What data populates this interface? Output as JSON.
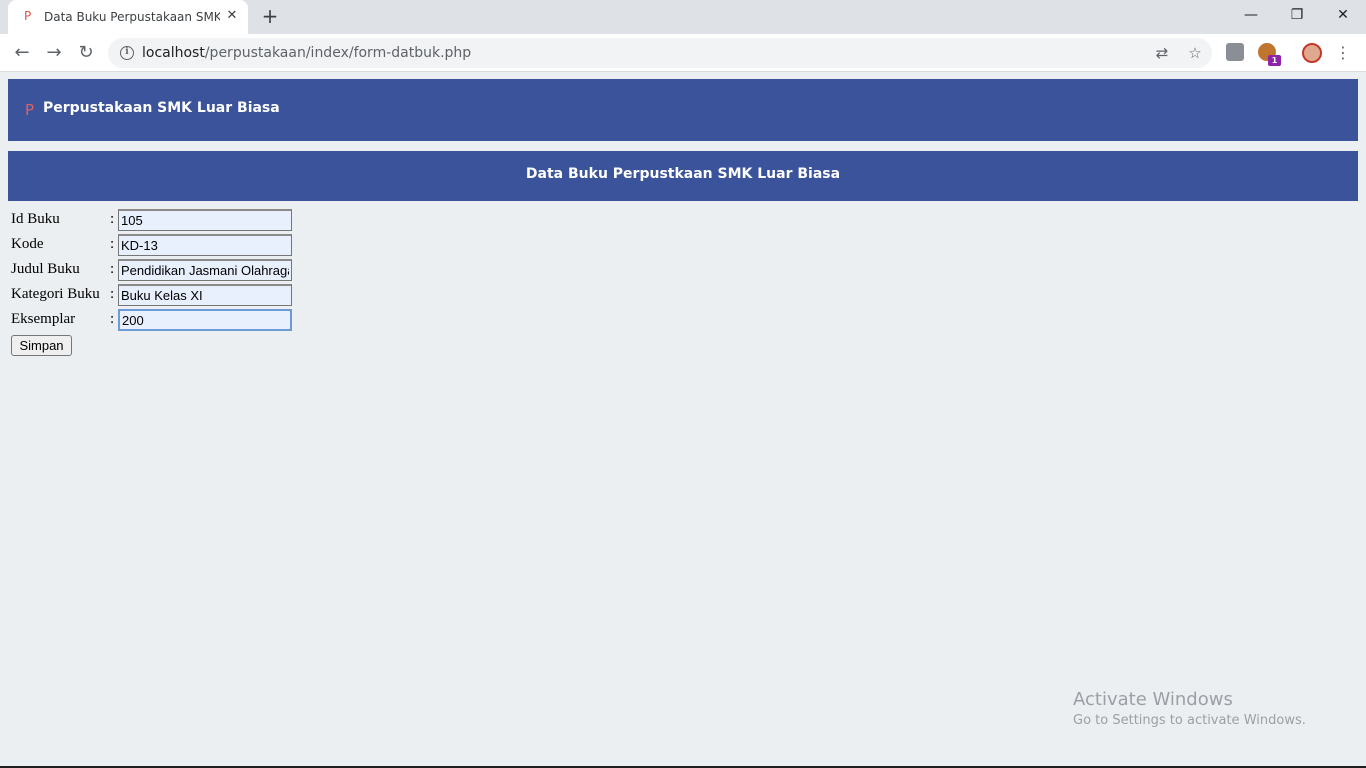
{
  "browser": {
    "tab": {
      "favicon": "P",
      "title": "Data Buku Perpustakaan SMK Luar Biasa",
      "close_glyph": "✕"
    },
    "new_tab_glyph": "+",
    "window_controls": {
      "minimize": "—",
      "restore": "❐",
      "close": "✕"
    },
    "nav": {
      "back": "←",
      "forward": "→",
      "reload": "↻"
    },
    "address": {
      "host": "localhost",
      "path": "/perpustakaan/index/form-datbuk.php"
    },
    "omnibox_icons": [
      "translate-icon",
      "star-icon"
    ],
    "extensions": [
      "extension-icon",
      "extension-icon"
    ],
    "extension_badge": "1",
    "menu_glyph": "⋮"
  },
  "page": {
    "header": {
      "icon": "P",
      "title": "Perpustakaan SMK Luar Biasa"
    },
    "section_title": "Data Buku Perpustkaan SMK Luar Biasa",
    "form": {
      "fields": [
        {
          "label": "Id Buku",
          "value": "105"
        },
        {
          "label": "Kode",
          "value": "KD-13"
        },
        {
          "label": "Judul Buku",
          "value": "Pendidikan Jasmani Olahraga"
        },
        {
          "label": "Kategori Buku",
          "value": "Buku Kelas XI"
        },
        {
          "label": "Eksemplar",
          "value": "200"
        }
      ],
      "separator": ":",
      "submit_label": "Simpan"
    }
  },
  "watermark": {
    "line1": "Activate Windows",
    "line2": "Go to Settings to activate Windows."
  },
  "colors": {
    "header_bg": "#3b539b",
    "page_bg": "#eceff1",
    "input_bg": "#e8f0fe"
  }
}
